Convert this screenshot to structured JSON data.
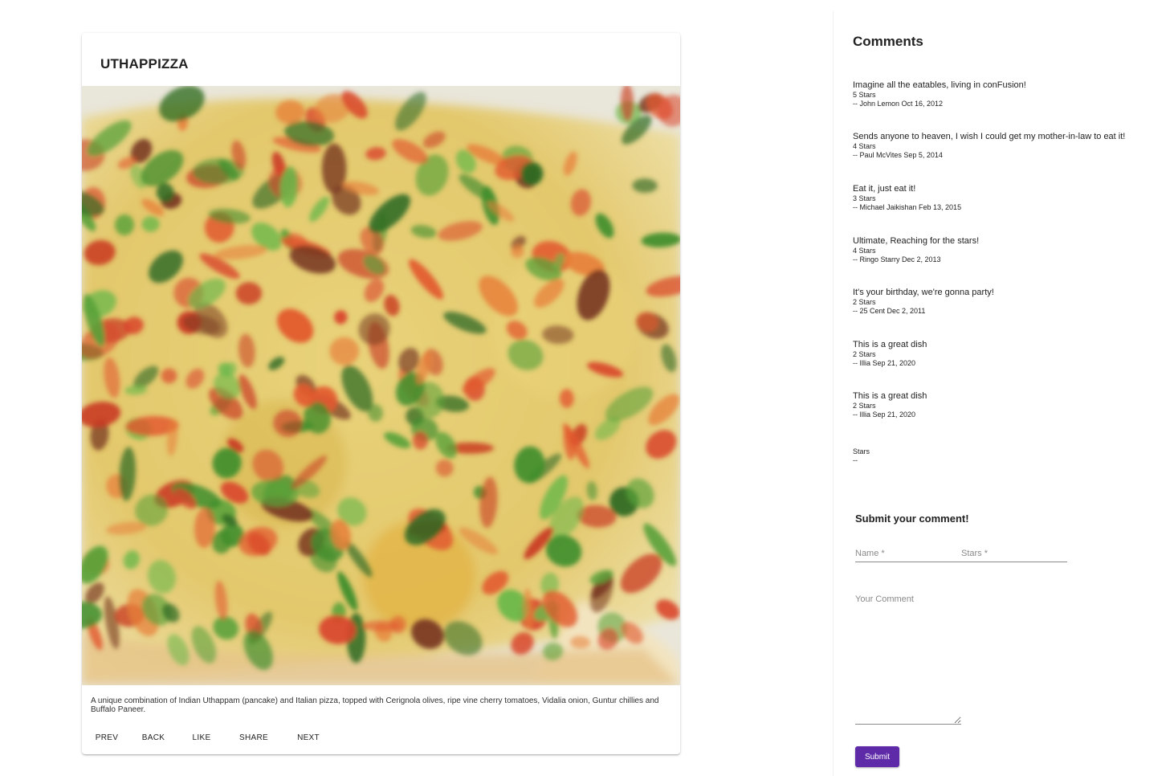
{
  "dish": {
    "name": "UTHAPPIZZA",
    "image_alt": "uthappizza",
    "description": "A unique combination of Indian Uthappam (pancake) and Italian pizza, topped with Cerignola olives, ripe vine cherry tomatoes, Vidalia onion, Guntur chillies and Buffalo Paneer.",
    "actions": [
      "PREV",
      "BACK",
      "LIKE",
      "SHARE",
      "NEXT"
    ]
  },
  "comments": {
    "heading": "Comments",
    "items": [
      {
        "text": "Imagine all the eatables, living in conFusion!",
        "stars": "5 Stars",
        "meta": "-- John Lemon Oct 16, 2012"
      },
      {
        "text": "Sends anyone to heaven, I wish I could get my mother-in-law to eat it!",
        "stars": "4 Stars",
        "meta": "-- Paul McVites Sep 5, 2014"
      },
      {
        "text": "Eat it, just eat it!",
        "stars": "3 Stars",
        "meta": "-- Michael Jaikishan Feb 13, 2015"
      },
      {
        "text": "Ultimate, Reaching for the stars!",
        "stars": "4 Stars",
        "meta": "-- Ringo Starry Dec 2, 2013"
      },
      {
        "text": "It's your birthday, we're gonna party!",
        "stars": "2 Stars",
        "meta": "-- 25 Cent Dec 2, 2011"
      },
      {
        "text": "This is a great dish",
        "stars": "2 Stars",
        "meta": "-- Illia Sep 21, 2020"
      },
      {
        "text": "This is a great dish",
        "stars": "2 Stars",
        "meta": "-- Illia Sep 21, 2020"
      },
      {
        "text": "",
        "stars": "Stars",
        "meta": "--"
      }
    ]
  },
  "form": {
    "title": "Submit your comment!",
    "name_placeholder": "Name *",
    "stars_placeholder": "Stars *",
    "comment_placeholder": "Your Comment",
    "submit_label": "Submit",
    "accent_color": "#5e2aa7"
  }
}
